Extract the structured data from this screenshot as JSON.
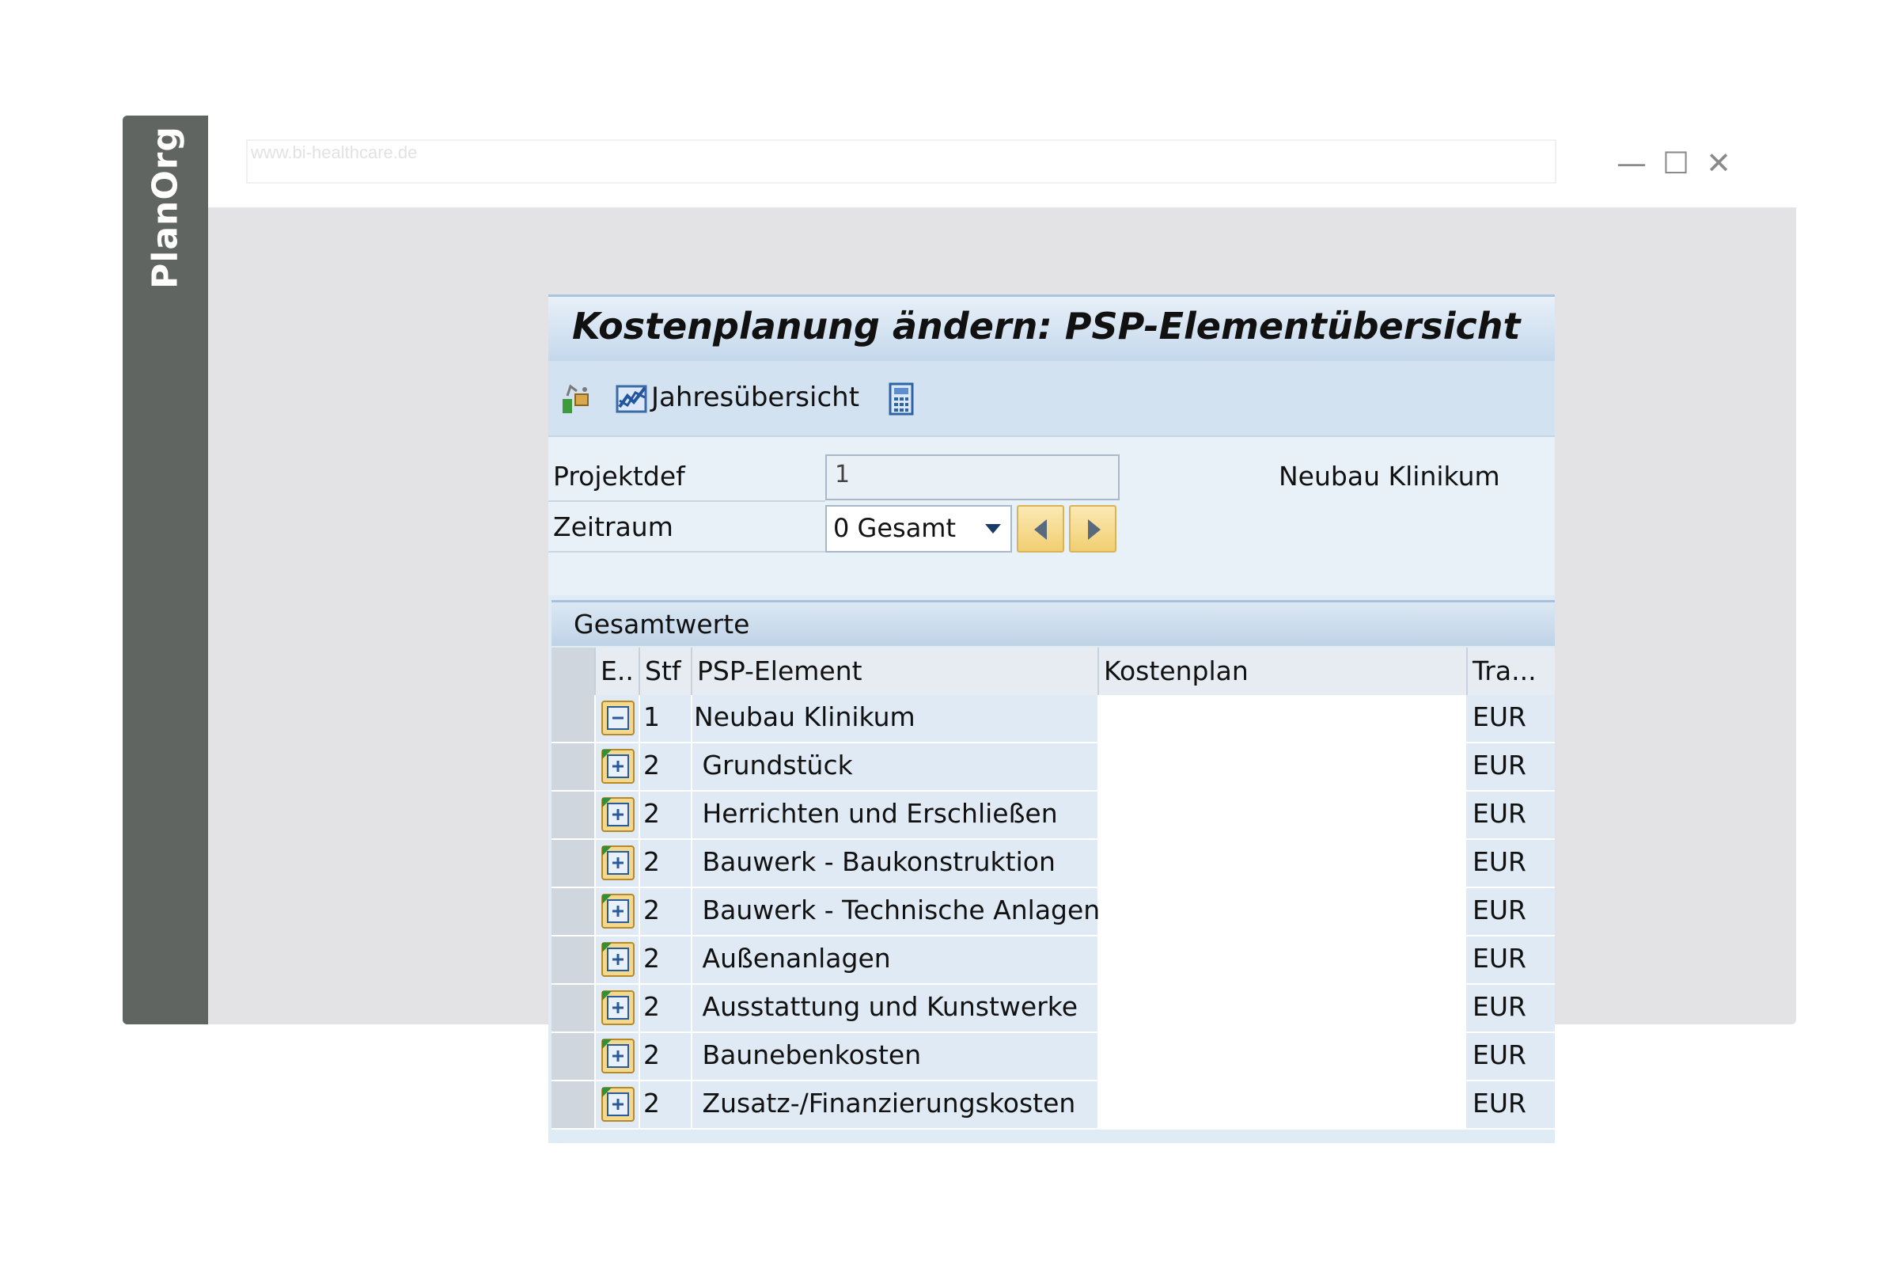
{
  "browser": {
    "url": "www.bi-healthcare.de",
    "brand": "PlanOrg",
    "controls": {
      "minimize": "—",
      "maximize": "☐",
      "close": "✕"
    }
  },
  "sap": {
    "title": "Kostenplanung ändern: PSP-Elementübersicht",
    "toolbar": {
      "jahres_label": "Jahresübersicht",
      "icons": [
        "settings-icon",
        "chart-icon",
        "calculator-icon"
      ]
    },
    "form": {
      "projektdef_label": "Projektdef",
      "projektdef_value": "1",
      "projekt_desc": "Neubau Klinikum",
      "zeitraum_label": "Zeitraum",
      "zeitraum_value": "0 Gesamt"
    },
    "section_title": "Gesamtwerte",
    "table": {
      "headers": [
        "E..",
        "Stf",
        "PSP-Element",
        "Kostenplan",
        "Tra..."
      ],
      "rows": [
        {
          "stf": "1",
          "psp": "Neubau Klinikum",
          "kost": "",
          "tra": "EUR",
          "expanded": true
        },
        {
          "stf": "2",
          "psp": " Grundstück",
          "kost": "",
          "tra": "EUR",
          "expanded": false
        },
        {
          "stf": "2",
          "psp": " Herrichten und Erschließen",
          "kost": "",
          "tra": "EUR",
          "expanded": false
        },
        {
          "stf": "2",
          "psp": " Bauwerk - Baukonstruktion",
          "kost": "",
          "tra": "EUR",
          "expanded": false
        },
        {
          "stf": "2",
          "psp": " Bauwerk - Technische Anlagen",
          "kost": "",
          "tra": "EUR",
          "expanded": false
        },
        {
          "stf": "2",
          "psp": " Außenanlagen",
          "kost": "",
          "tra": "EUR",
          "expanded": false
        },
        {
          "stf": "2",
          "psp": " Ausstattung und Kunstwerke",
          "kost": "",
          "tra": "EUR",
          "expanded": false
        },
        {
          "stf": "2",
          "psp": " Baunebenkosten",
          "kost": "",
          "tra": "EUR",
          "expanded": false
        },
        {
          "stf": "2",
          "psp": " Zusatz-/Finanzierungskosten",
          "kost": "",
          "tra": "EUR",
          "expanded": false
        }
      ]
    }
  },
  "colors": {
    "brand_bar": "#606561",
    "sap_title_bg": "#c4d8ec",
    "nav_button": "#f1cf72"
  }
}
